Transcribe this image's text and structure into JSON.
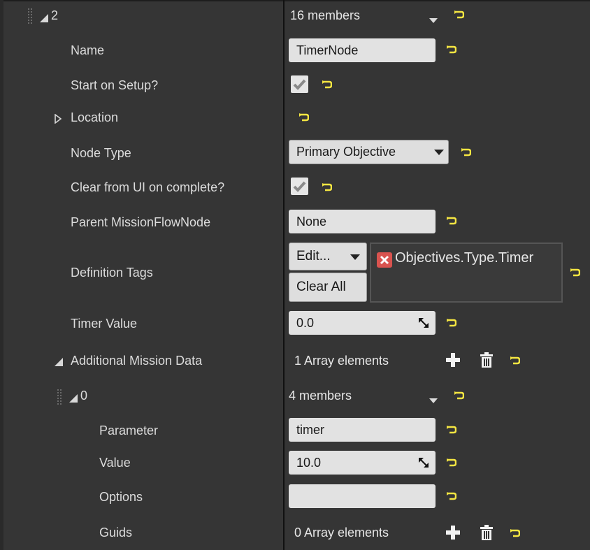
{
  "element2": {
    "index": "2",
    "members": "16 members"
  },
  "props": {
    "name_label": "Name",
    "name_value": "TimerNode",
    "start_label": "Start on Setup?",
    "location_label": "Location",
    "nodetype_label": "Node Type",
    "nodetype_value": "Primary Objective",
    "clear_label": "Clear from UI on complete?",
    "parent_label": "Parent MissionFlowNode",
    "parent_value": "None",
    "deftags_label": "Definition Tags",
    "edit_label": "Edit...",
    "clear_all_label": "Clear All",
    "tag_value": "Objectives.Type.Timer",
    "timer_label": "Timer Value",
    "timer_value": "0.0",
    "additional_label": "Additional Mission Data",
    "additional_count": "1 Array elements"
  },
  "element0": {
    "index": "0",
    "members": "4 members",
    "parameter_label": "Parameter",
    "parameter_value": "timer",
    "value_label": "Value",
    "value_value": "10.0",
    "options_label": "Options",
    "options_value": "",
    "guids_label": "Guids",
    "guids_count": "0 Array elements"
  },
  "checkboxes": {
    "start_on_setup": true,
    "clear_from_ui": true
  },
  "colors": {
    "reset_arrow": "#f5e642",
    "tag_remove": "#d9534f"
  }
}
